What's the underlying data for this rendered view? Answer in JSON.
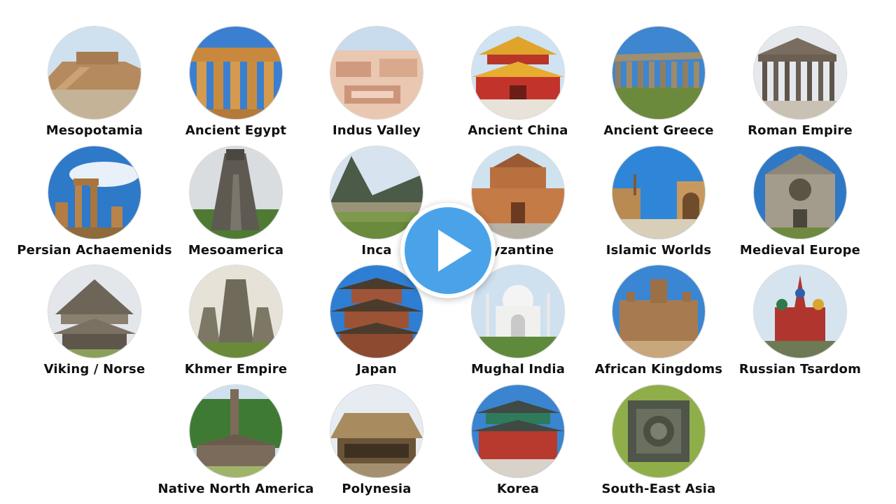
{
  "tiles": [
    {
      "label": "Mesopotamia",
      "theme": "ziggurat"
    },
    {
      "label": "Ancient Egypt",
      "theme": "temple-columns"
    },
    {
      "label": "Indus Valley",
      "theme": "brick-ruins"
    },
    {
      "label": "Ancient China",
      "theme": "palace-roof"
    },
    {
      "label": "Ancient Greece",
      "theme": "greek-temple"
    },
    {
      "label": "Roman Empire",
      "theme": "pantheon"
    },
    {
      "label": "Persian Achaemenids",
      "theme": "gate-ruins"
    },
    {
      "label": "Mesoamerica",
      "theme": "step-pyramid"
    },
    {
      "label": "Inca",
      "theme": "mountain-terraces"
    },
    {
      "label": "Byzantine",
      "theme": "basilica"
    },
    {
      "label": "Islamic Worlds",
      "theme": "courtyard-mosque"
    },
    {
      "label": "Medieval Europe",
      "theme": "gothic-facade"
    },
    {
      "label": "Viking / Norse",
      "theme": "longhouse"
    },
    {
      "label": "Khmer Empire",
      "theme": "stone-temple"
    },
    {
      "label": "Japan",
      "theme": "pagoda"
    },
    {
      "label": "Mughal India",
      "theme": "domed-mausoleum"
    },
    {
      "label": "African Kingdoms",
      "theme": "mud-mosque"
    },
    {
      "label": "Russian Tsardom",
      "theme": "onion-domes"
    },
    {
      "label": "Native North America",
      "theme": "totem-longhouse"
    },
    {
      "label": "Polynesia",
      "theme": "thatched-hut"
    },
    {
      "label": "Korea",
      "theme": "korean-palace"
    },
    {
      "label": "South-East Asia",
      "theme": "stupa-aerial"
    }
  ],
  "play": {
    "icon": "play-icon",
    "color": "#4aa3e8"
  }
}
